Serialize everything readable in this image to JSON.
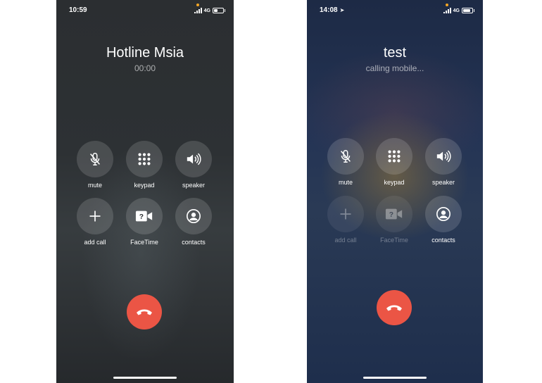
{
  "left_screen": {
    "status": {
      "time": "10:59",
      "network": "4G"
    },
    "caller": {
      "name": "Hotline Msia",
      "status": "00:00"
    },
    "buttons": {
      "mute": "mute",
      "keypad": "keypad",
      "speaker": "speaker",
      "add_call": "add call",
      "facetime": "FaceTime",
      "contacts": "contacts"
    }
  },
  "right_screen": {
    "status": {
      "time": "14:08",
      "network": "4G"
    },
    "caller": {
      "name": "test",
      "status": "calling mobile..."
    },
    "buttons": {
      "mute": "mute",
      "keypad": "keypad",
      "speaker": "speaker",
      "add_call": "add call",
      "facetime": "FaceTime",
      "contacts": "contacts"
    },
    "disabled_buttons": [
      "add call",
      "FaceTime"
    ]
  },
  "colors": {
    "end_call": "#eb5545",
    "indicator_dot": "#f5a623",
    "left_background": "#2d3134",
    "right_background": "#243455"
  },
  "icons": [
    "muted-microphone-icon",
    "keypad-grid-icon",
    "speaker-icon",
    "plus-icon",
    "facetime-camera-icon",
    "contact-icon",
    "hang-up-icon",
    "location-arrow-icon"
  ]
}
